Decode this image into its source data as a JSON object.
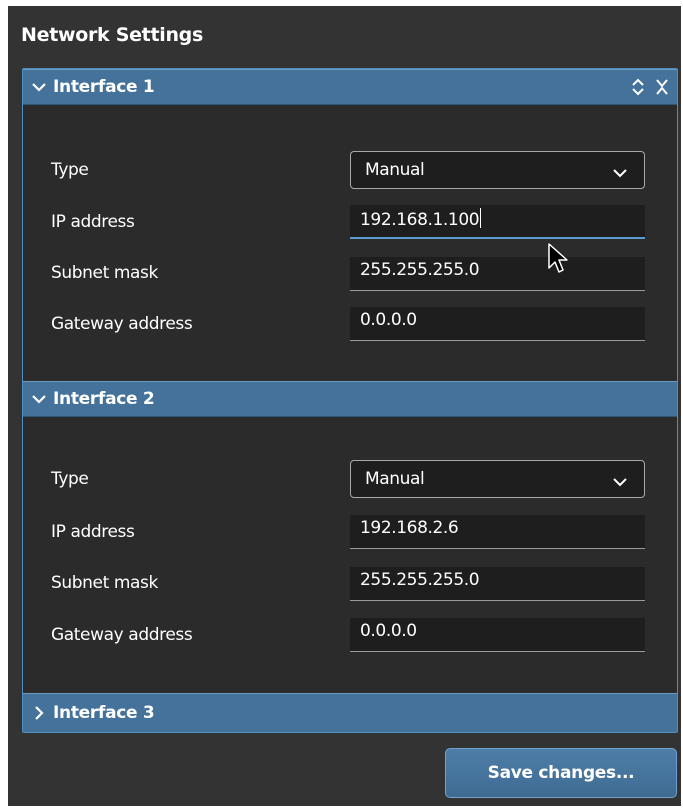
{
  "panel": {
    "title": "Network Settings"
  },
  "interfaces": [
    {
      "label": "Interface 1",
      "expanded": true,
      "type_label": "Type",
      "type_value": "Manual",
      "ip_label": "IP address",
      "ip_value": "192.168.1.100",
      "subnet_label": "Subnet mask",
      "subnet_value": "255.255.255.0",
      "gateway_label": "Gateway address",
      "gateway_value": "0.0.0.0"
    },
    {
      "label": "Interface 2",
      "expanded": true,
      "type_label": "Type",
      "type_value": "Manual",
      "ip_label": "IP address",
      "ip_value": "192.168.2.6",
      "subnet_label": "Subnet mask",
      "subnet_value": "255.255.255.0",
      "gateway_label": "Gateway address",
      "gateway_value": "0.0.0.0"
    },
    {
      "label": "Interface 3",
      "expanded": false
    }
  ],
  "toolbar": {
    "save_label": "Save changes..."
  },
  "icons": {
    "expand": "chevron-down-icon",
    "collapsed": "chevron-right-icon",
    "expand_collapse_all": "expand-collapse-icon",
    "close": "close-icon",
    "dropdown": "chevron-down-icon",
    "cursor": "mouse-pointer-icon"
  },
  "colors": {
    "panel_bg": "#333333",
    "header_bg": "#45729a",
    "accent": "#5b9bd1",
    "input_bg": "#1e1e1e"
  }
}
